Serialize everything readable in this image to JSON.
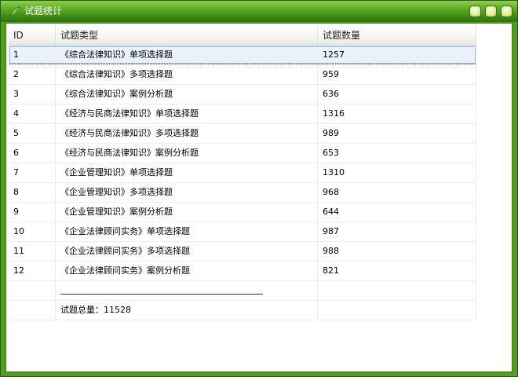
{
  "window": {
    "title": "试题统计"
  },
  "table": {
    "headers": {
      "id": "ID",
      "type": "试题类型",
      "count": "试题数量"
    },
    "rows": [
      {
        "id": "1",
        "type": "《综合法律知识》单项选择题",
        "count": "1257"
      },
      {
        "id": "2",
        "type": "《综合法律知识》多项选择题",
        "count": "959"
      },
      {
        "id": "3",
        "type": "《综合法律知识》案例分析题",
        "count": "636"
      },
      {
        "id": "4",
        "type": "《经济与民商法律知识》单项选择题",
        "count": "1316"
      },
      {
        "id": "5",
        "type": "《经济与民商法律知识》多项选择题",
        "count": "989"
      },
      {
        "id": "6",
        "type": "《经济与民商法律知识》案例分析题",
        "count": "653"
      },
      {
        "id": "7",
        "type": "《企业管理知识》单项选择题",
        "count": "1310"
      },
      {
        "id": "8",
        "type": "《企业管理知识》多项选择题",
        "count": "968"
      },
      {
        "id": "9",
        "type": "《企业管理知识》案例分析题",
        "count": "644"
      },
      {
        "id": "10",
        "type": "《企业法律顾问实务》单项选择题",
        "count": "987"
      },
      {
        "id": "11",
        "type": "《企业法律顾问实务》多项选择题",
        "count": "988"
      },
      {
        "id": "12",
        "type": "《企业法律顾问实务》案例分析题",
        "count": "821"
      }
    ],
    "selected_row": 1,
    "total": "试题总量：11528"
  },
  "icons": {
    "title_icon": "leaf-icon",
    "minimize": "minimize-icon",
    "maximize": "maximize-icon",
    "close": "close-icon"
  },
  "colors": {
    "titlebar": "#4f9e1c",
    "selection": "#eaf1fb"
  }
}
